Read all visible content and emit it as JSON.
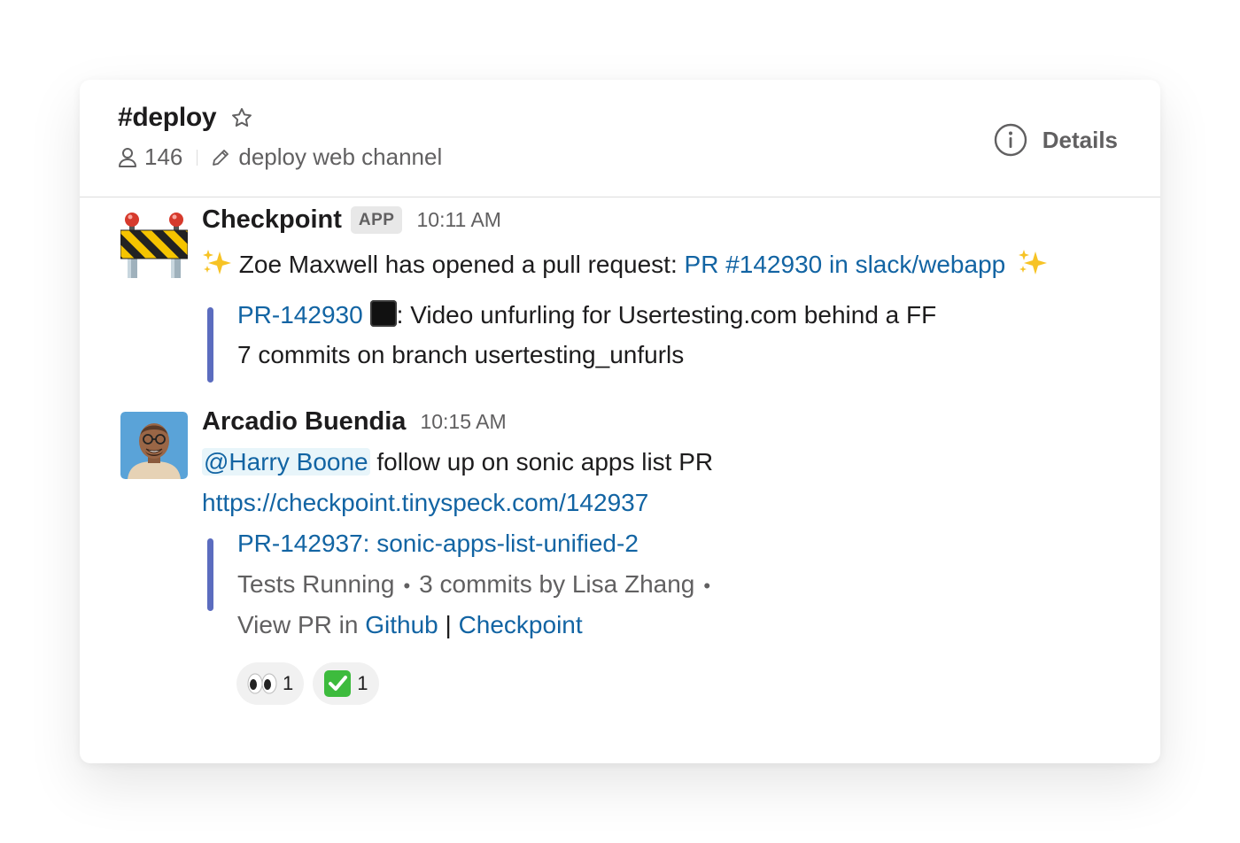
{
  "header": {
    "channel": "#deploy",
    "member_count": "146",
    "topic": "deploy web channel",
    "details_label": "Details"
  },
  "messages": [
    {
      "sender": "Checkpoint",
      "badge": "APP",
      "time": "10:11 AM",
      "text_prefix": "Zoe Maxwell has opened a pull request: ",
      "link": "PR #142930 in slack/webapp",
      "attachment": {
        "title_link": "PR-142930",
        "title_rest": ": Video unfurling for Usertesting.com behind a FF",
        "subtitle": "7 commits on branch usertesting_unfurls"
      }
    },
    {
      "sender": "Arcadio Buendia",
      "time": "10:15 AM",
      "mention": "@Harry Boone",
      "text": " follow up on sonic apps list PR",
      "url": "https://checkpoint.tinyspeck.com/142937",
      "attachment": {
        "title": "PR-142937: sonic-apps-list-unified-2",
        "status": "Tests Running",
        "commits": "3 commits by Lisa Zhang",
        "view_prefix": "View PR in ",
        "github": "Github",
        "separator": " | ",
        "checkpoint": "Checkpoint"
      },
      "reactions": [
        {
          "emoji": "eyes-icon",
          "count": "1"
        },
        {
          "emoji": "white-check-mark-icon",
          "count": "1"
        }
      ]
    }
  ],
  "colors": {
    "link": "#1264a3",
    "attachment_bar": "#5b6cbf",
    "muted": "#616061"
  }
}
